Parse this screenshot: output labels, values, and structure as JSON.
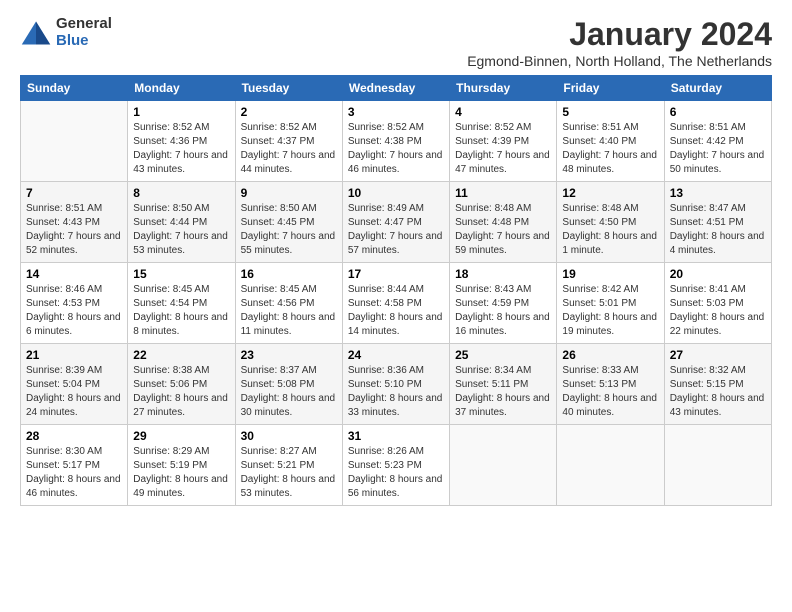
{
  "logo": {
    "general": "General",
    "blue": "Blue"
  },
  "title": "January 2024",
  "subtitle": "Egmond-Binnen, North Holland, The Netherlands",
  "columns": [
    "Sunday",
    "Monday",
    "Tuesday",
    "Wednesday",
    "Thursday",
    "Friday",
    "Saturday"
  ],
  "weeks": [
    [
      {
        "day": "",
        "sunrise": "",
        "sunset": "",
        "daylight": ""
      },
      {
        "day": "1",
        "sunrise": "Sunrise: 8:52 AM",
        "sunset": "Sunset: 4:36 PM",
        "daylight": "Daylight: 7 hours and 43 minutes."
      },
      {
        "day": "2",
        "sunrise": "Sunrise: 8:52 AM",
        "sunset": "Sunset: 4:37 PM",
        "daylight": "Daylight: 7 hours and 44 minutes."
      },
      {
        "day": "3",
        "sunrise": "Sunrise: 8:52 AM",
        "sunset": "Sunset: 4:38 PM",
        "daylight": "Daylight: 7 hours and 46 minutes."
      },
      {
        "day": "4",
        "sunrise": "Sunrise: 8:52 AM",
        "sunset": "Sunset: 4:39 PM",
        "daylight": "Daylight: 7 hours and 47 minutes."
      },
      {
        "day": "5",
        "sunrise": "Sunrise: 8:51 AM",
        "sunset": "Sunset: 4:40 PM",
        "daylight": "Daylight: 7 hours and 48 minutes."
      },
      {
        "day": "6",
        "sunrise": "Sunrise: 8:51 AM",
        "sunset": "Sunset: 4:42 PM",
        "daylight": "Daylight: 7 hours and 50 minutes."
      }
    ],
    [
      {
        "day": "7",
        "sunrise": "Sunrise: 8:51 AM",
        "sunset": "Sunset: 4:43 PM",
        "daylight": "Daylight: 7 hours and 52 minutes."
      },
      {
        "day": "8",
        "sunrise": "Sunrise: 8:50 AM",
        "sunset": "Sunset: 4:44 PM",
        "daylight": "Daylight: 7 hours and 53 minutes."
      },
      {
        "day": "9",
        "sunrise": "Sunrise: 8:50 AM",
        "sunset": "Sunset: 4:45 PM",
        "daylight": "Daylight: 7 hours and 55 minutes."
      },
      {
        "day": "10",
        "sunrise": "Sunrise: 8:49 AM",
        "sunset": "Sunset: 4:47 PM",
        "daylight": "Daylight: 7 hours and 57 minutes."
      },
      {
        "day": "11",
        "sunrise": "Sunrise: 8:48 AM",
        "sunset": "Sunset: 4:48 PM",
        "daylight": "Daylight: 7 hours and 59 minutes."
      },
      {
        "day": "12",
        "sunrise": "Sunrise: 8:48 AM",
        "sunset": "Sunset: 4:50 PM",
        "daylight": "Daylight: 8 hours and 1 minute."
      },
      {
        "day": "13",
        "sunrise": "Sunrise: 8:47 AM",
        "sunset": "Sunset: 4:51 PM",
        "daylight": "Daylight: 8 hours and 4 minutes."
      }
    ],
    [
      {
        "day": "14",
        "sunrise": "Sunrise: 8:46 AM",
        "sunset": "Sunset: 4:53 PM",
        "daylight": "Daylight: 8 hours and 6 minutes."
      },
      {
        "day": "15",
        "sunrise": "Sunrise: 8:45 AM",
        "sunset": "Sunset: 4:54 PM",
        "daylight": "Daylight: 8 hours and 8 minutes."
      },
      {
        "day": "16",
        "sunrise": "Sunrise: 8:45 AM",
        "sunset": "Sunset: 4:56 PM",
        "daylight": "Daylight: 8 hours and 11 minutes."
      },
      {
        "day": "17",
        "sunrise": "Sunrise: 8:44 AM",
        "sunset": "Sunset: 4:58 PM",
        "daylight": "Daylight: 8 hours and 14 minutes."
      },
      {
        "day": "18",
        "sunrise": "Sunrise: 8:43 AM",
        "sunset": "Sunset: 4:59 PM",
        "daylight": "Daylight: 8 hours and 16 minutes."
      },
      {
        "day": "19",
        "sunrise": "Sunrise: 8:42 AM",
        "sunset": "Sunset: 5:01 PM",
        "daylight": "Daylight: 8 hours and 19 minutes."
      },
      {
        "day": "20",
        "sunrise": "Sunrise: 8:41 AM",
        "sunset": "Sunset: 5:03 PM",
        "daylight": "Daylight: 8 hours and 22 minutes."
      }
    ],
    [
      {
        "day": "21",
        "sunrise": "Sunrise: 8:39 AM",
        "sunset": "Sunset: 5:04 PM",
        "daylight": "Daylight: 8 hours and 24 minutes."
      },
      {
        "day": "22",
        "sunrise": "Sunrise: 8:38 AM",
        "sunset": "Sunset: 5:06 PM",
        "daylight": "Daylight: 8 hours and 27 minutes."
      },
      {
        "day": "23",
        "sunrise": "Sunrise: 8:37 AM",
        "sunset": "Sunset: 5:08 PM",
        "daylight": "Daylight: 8 hours and 30 minutes."
      },
      {
        "day": "24",
        "sunrise": "Sunrise: 8:36 AM",
        "sunset": "Sunset: 5:10 PM",
        "daylight": "Daylight: 8 hours and 33 minutes."
      },
      {
        "day": "25",
        "sunrise": "Sunrise: 8:34 AM",
        "sunset": "Sunset: 5:11 PM",
        "daylight": "Daylight: 8 hours and 37 minutes."
      },
      {
        "day": "26",
        "sunrise": "Sunrise: 8:33 AM",
        "sunset": "Sunset: 5:13 PM",
        "daylight": "Daylight: 8 hours and 40 minutes."
      },
      {
        "day": "27",
        "sunrise": "Sunrise: 8:32 AM",
        "sunset": "Sunset: 5:15 PM",
        "daylight": "Daylight: 8 hours and 43 minutes."
      }
    ],
    [
      {
        "day": "28",
        "sunrise": "Sunrise: 8:30 AM",
        "sunset": "Sunset: 5:17 PM",
        "daylight": "Daylight: 8 hours and 46 minutes."
      },
      {
        "day": "29",
        "sunrise": "Sunrise: 8:29 AM",
        "sunset": "Sunset: 5:19 PM",
        "daylight": "Daylight: 8 hours and 49 minutes."
      },
      {
        "day": "30",
        "sunrise": "Sunrise: 8:27 AM",
        "sunset": "Sunset: 5:21 PM",
        "daylight": "Daylight: 8 hours and 53 minutes."
      },
      {
        "day": "31",
        "sunrise": "Sunrise: 8:26 AM",
        "sunset": "Sunset: 5:23 PM",
        "daylight": "Daylight: 8 hours and 56 minutes."
      },
      {
        "day": "",
        "sunrise": "",
        "sunset": "",
        "daylight": ""
      },
      {
        "day": "",
        "sunrise": "",
        "sunset": "",
        "daylight": ""
      },
      {
        "day": "",
        "sunrise": "",
        "sunset": "",
        "daylight": ""
      }
    ]
  ]
}
